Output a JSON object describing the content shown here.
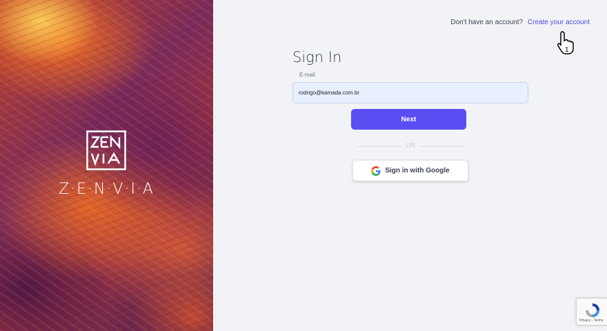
{
  "brand": {
    "wordmark": "Z·E·N·V·I·A",
    "logo_icon": "zenvia-logo-icon"
  },
  "header": {
    "no_account_text": "Don't have an account?",
    "create_account_link": "Create your account",
    "cursor_label": "1"
  },
  "form": {
    "title": "Sign In",
    "email_label": "E-mail",
    "email_value": "rodrigo@kamada.com.br",
    "next_button": "Next",
    "divider_text": "OR",
    "google_button": "Sign in with Google"
  },
  "recaptcha": {
    "links": "Privacy - Terms"
  },
  "colors": {
    "accent": "#5a4df2",
    "link": "#5147e6",
    "background": "#f1f3f6"
  }
}
